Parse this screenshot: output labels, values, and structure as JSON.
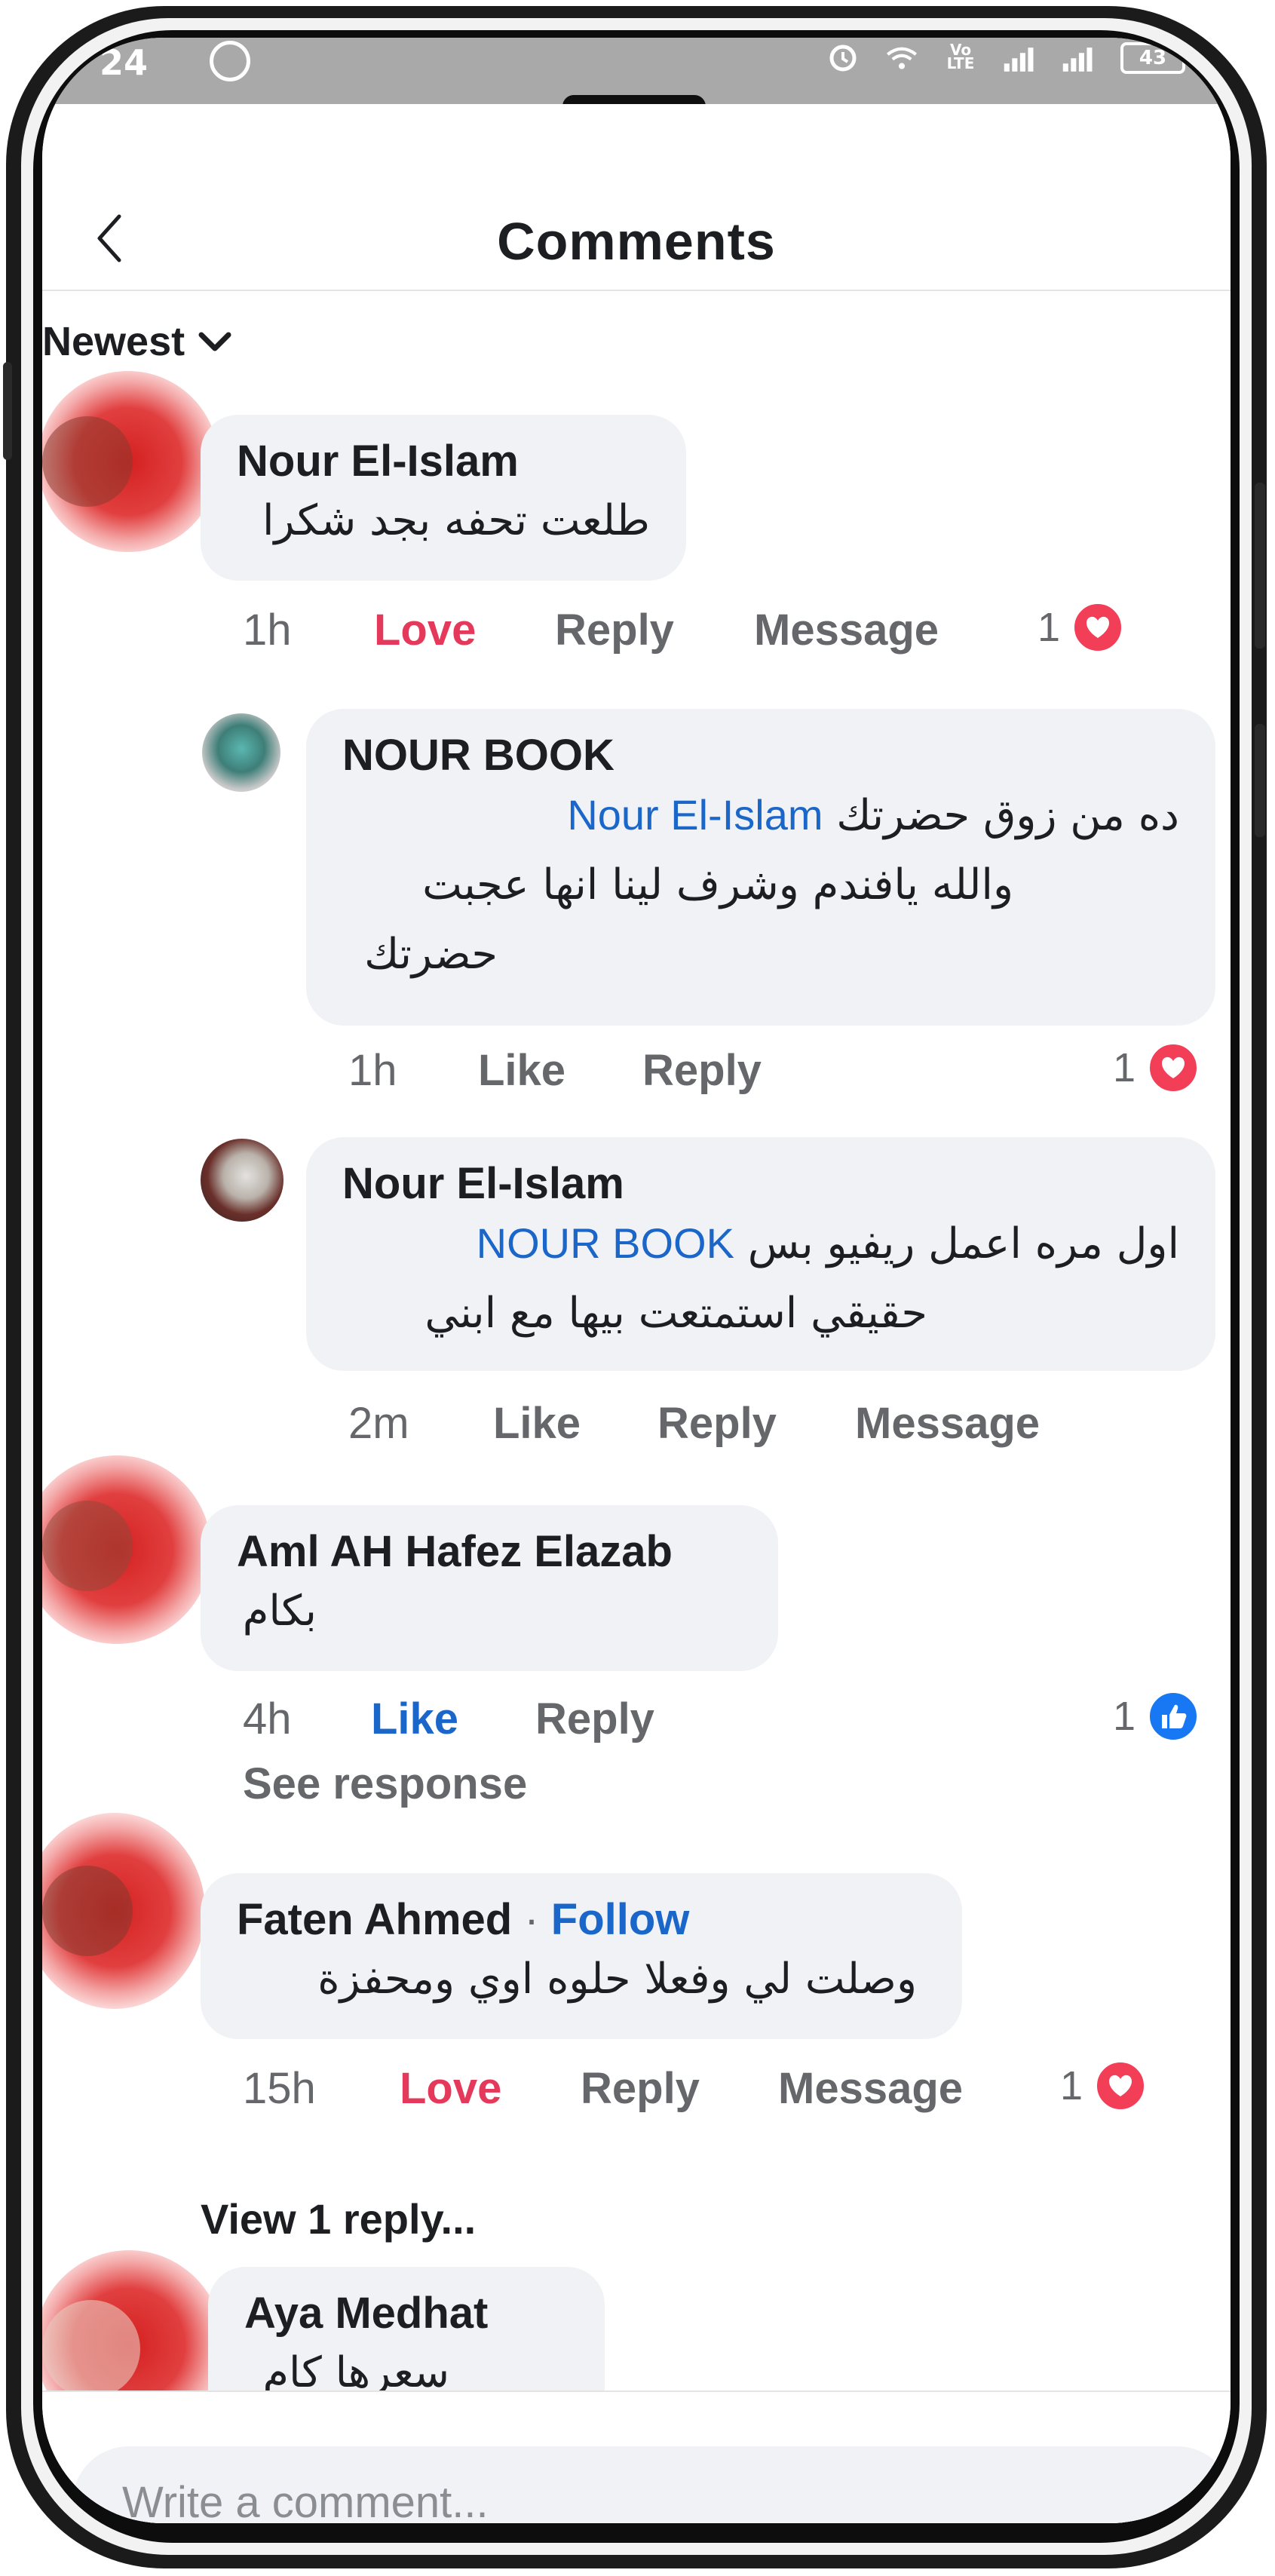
{
  "status_bar": {
    "time": "24",
    "battery": "43",
    "network_label": "Vo LTE",
    "icons": [
      "sync-icon",
      "alarm-icon",
      "wifi-icon",
      "signal-icon",
      "battery-icon"
    ]
  },
  "header": {
    "title": "Comments",
    "back_icon": "chevron-left-icon"
  },
  "sort": {
    "label": "Newest"
  },
  "comments": [
    {
      "name": "Nour El-Islam",
      "text": "طلعت تحفه بجد شكرا",
      "time": "1h",
      "reaction_action": "Love",
      "reply": "Reply",
      "message": "Message",
      "reaction_count": "1",
      "reaction_type": "heart-icon"
    },
    {
      "name": "NOUR BOOK",
      "mention": "Nour El-Islam",
      "text_line1": "ده من زوق حضرتك",
      "text_line2": "والله يافندم وشرف لينا انها عجبت",
      "text_line3": "حضرتك",
      "time": "1h",
      "like": "Like",
      "reply": "Reply",
      "reaction_count": "1",
      "reaction_type": "heart-icon"
    },
    {
      "name": "Nour El-Islam",
      "mention": "NOUR BOOK",
      "text_line1": "اول مره اعمل ريفيو بس",
      "text_line2": "حقيقي استمتعت بيها مع ابني",
      "time": "2m",
      "like": "Like",
      "reply": "Reply",
      "message": "Message"
    },
    {
      "name": "Aml AH Hafez Elazab",
      "text": "بكام",
      "time": "4h",
      "like": "Like",
      "reply": "Reply",
      "reaction_count": "1",
      "reaction_type": "thumbs-up-icon",
      "see_response": "See response"
    },
    {
      "name": "Faten Ahmed",
      "follow": "Follow",
      "text": "وصلت لي وفعلا حلوه اوي ومحفزة",
      "time": "15h",
      "reaction_action": "Love",
      "reply": "Reply",
      "message": "Message",
      "reaction_count": "1",
      "reaction_type": "heart-icon",
      "view_replies": "View 1 reply..."
    },
    {
      "name": "Aya Medhat",
      "text": "سعرها كام"
    }
  ],
  "composer": {
    "placeholder": "Write a comment..."
  },
  "colors": {
    "accent_blue": "#1a66c9",
    "love_red": "#e5395b",
    "bubble_bg": "#f0f2f5",
    "meta_gray": "#65676b"
  }
}
